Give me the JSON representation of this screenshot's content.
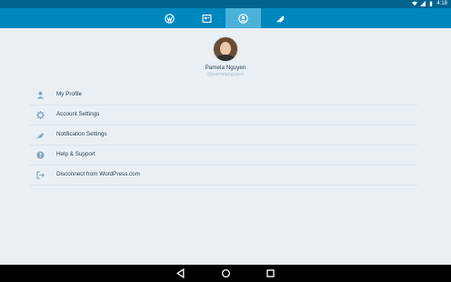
{
  "status_bar": {
    "time": "4:18",
    "icons": [
      "wifi-icon",
      "signal-icon",
      "battery-icon"
    ]
  },
  "tabs": [
    {
      "name": "reader",
      "icon": "wordpress-icon",
      "active": false
    },
    {
      "name": "sites",
      "icon": "sites-icon",
      "active": false
    },
    {
      "name": "me",
      "icon": "profile-icon",
      "active": true
    },
    {
      "name": "notifications",
      "icon": "notifications-icon",
      "active": false
    }
  ],
  "profile": {
    "display_name": "Pamela Nguyen",
    "username": "@pamelanguyen"
  },
  "menu": [
    {
      "label": "My Profile",
      "icon": "person-icon"
    },
    {
      "label": "Account Settings",
      "icon": "gear-icon"
    },
    {
      "label": "Notification Settings",
      "icon": "bell-icon"
    },
    {
      "label": "Help & Support",
      "icon": "help-icon"
    },
    {
      "label": "Disconnect from WordPress.com",
      "icon": "sign-out-icon"
    }
  ],
  "nav": [
    "back-icon",
    "home-icon",
    "recents-icon"
  ],
  "colors": {
    "tabbar": "#0087be",
    "tab_active": "#4ab2d8",
    "statusbar": "#00648f",
    "background": "#e9eff3",
    "icon_gray": "#87a6bc"
  }
}
